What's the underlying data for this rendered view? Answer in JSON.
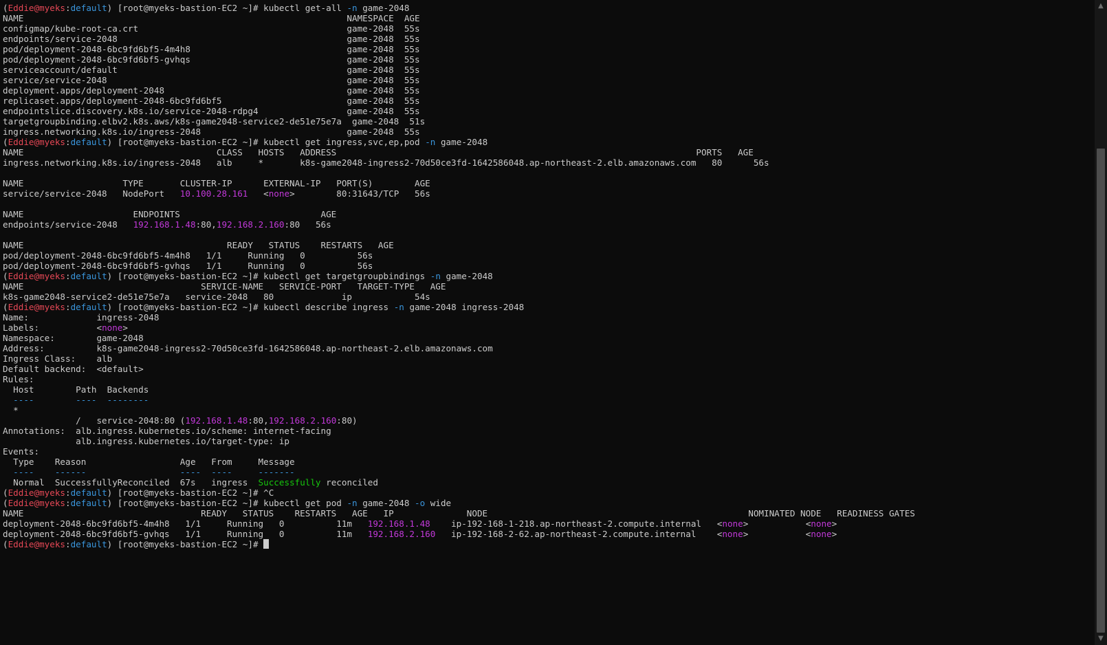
{
  "colors": {
    "background": "#0c0c0c",
    "text": "#cccccc",
    "user": "#e74856",
    "context": "#3a96dd",
    "flag": "#3a96dd",
    "ip": "#c239d9",
    "success": "#16c60c"
  },
  "scrollbar": {
    "up_icon": "chevron-up-icon",
    "down_icon": "chevron-down-icon",
    "position_fraction": 0.22,
    "visible_fraction": 0.78
  },
  "lines": [
    [
      [
        "p",
        "("
      ],
      [
        "user",
        "Eddie@myeks"
      ],
      [
        "p",
        ":"
      ],
      [
        "ctx",
        "default"
      ],
      [
        "p",
        ") [root@myeks-bastion-EC2 ~]# kubectl get-all "
      ],
      [
        "flag",
        "-n"
      ],
      [
        "p",
        " game-2048"
      ]
    ],
    [
      [
        "p",
        "NAME                                                              NAMESPACE  AGE"
      ]
    ],
    [
      [
        "p",
        "configmap/kube-root-ca.crt                                        game-2048  55s"
      ]
    ],
    [
      [
        "p",
        "endpoints/service-2048                                            game-2048  55s"
      ]
    ],
    [
      [
        "p",
        "pod/deployment-2048-6bc9fd6bf5-4m4h8                              game-2048  55s"
      ]
    ],
    [
      [
        "p",
        "pod/deployment-2048-6bc9fd6bf5-gvhqs                              game-2048  55s"
      ]
    ],
    [
      [
        "p",
        "serviceaccount/default                                            game-2048  55s"
      ]
    ],
    [
      [
        "p",
        "service/service-2048                                              game-2048  55s"
      ]
    ],
    [
      [
        "p",
        "deployment.apps/deployment-2048                                   game-2048  55s"
      ]
    ],
    [
      [
        "p",
        "replicaset.apps/deployment-2048-6bc9fd6bf5                        game-2048  55s"
      ]
    ],
    [
      [
        "p",
        "endpointslice.discovery.k8s.io/service-2048-rdpg4                 game-2048  55s"
      ]
    ],
    [
      [
        "p",
        "targetgroupbinding.elbv2.k8s.aws/k8s-game2048-service2-de51e75e7a  game-2048  51s"
      ]
    ],
    [
      [
        "p",
        "ingress.networking.k8s.io/ingress-2048                            game-2048  55s"
      ]
    ],
    [
      [
        "p",
        "("
      ],
      [
        "user",
        "Eddie@myeks"
      ],
      [
        "p",
        ":"
      ],
      [
        "ctx",
        "default"
      ],
      [
        "p",
        ") [root@myeks-bastion-EC2 ~]# kubectl get ingress,svc,ep,pod "
      ],
      [
        "flag",
        "-n"
      ],
      [
        "p",
        " game-2048"
      ]
    ],
    [
      [
        "p",
        "NAME                                     CLASS   HOSTS   ADDRESS                                                                     PORTS   AGE"
      ]
    ],
    [
      [
        "p",
        "ingress.networking.k8s.io/ingress-2048   alb     *       k8s-game2048-ingress2-70d50ce3fd-1642586048.ap-northeast-2.elb.amazonaws.com   80      56s"
      ]
    ],
    [
      [
        "p",
        ""
      ]
    ],
    [
      [
        "p",
        "NAME                   TYPE       CLUSTER-IP      EXTERNAL-IP   PORT(S)        AGE"
      ]
    ],
    [
      [
        "p",
        "service/service-2048   NodePort   "
      ],
      [
        "ip",
        "10.100.28.161"
      ],
      [
        "p",
        "   <"
      ],
      [
        "ip",
        "none"
      ],
      [
        "p",
        ">        80:31643/TCP   56s"
      ]
    ],
    [
      [
        "p",
        ""
      ]
    ],
    [
      [
        "p",
        "NAME                     ENDPOINTS                           AGE"
      ]
    ],
    [
      [
        "p",
        "endpoints/service-2048   "
      ],
      [
        "ip",
        "192.168.1.48"
      ],
      [
        "p",
        ":80,"
      ],
      [
        "ip",
        "192.168.2.160"
      ],
      [
        "p",
        ":80   56s"
      ]
    ],
    [
      [
        "p",
        ""
      ]
    ],
    [
      [
        "p",
        "NAME                                       READY   STATUS    RESTARTS   AGE"
      ]
    ],
    [
      [
        "p",
        "pod/deployment-2048-6bc9fd6bf5-4m4h8   1/1     Running   0          56s"
      ]
    ],
    [
      [
        "p",
        "pod/deployment-2048-6bc9fd6bf5-gvhqs   1/1     Running   0          56s"
      ]
    ],
    [
      [
        "p",
        "("
      ],
      [
        "user",
        "Eddie@myeks"
      ],
      [
        "p",
        ":"
      ],
      [
        "ctx",
        "default"
      ],
      [
        "p",
        ") [root@myeks-bastion-EC2 ~]# kubectl get targetgroupbindings "
      ],
      [
        "flag",
        "-n"
      ],
      [
        "p",
        " game-2048"
      ]
    ],
    [
      [
        "p",
        "NAME                                  SERVICE-NAME   SERVICE-PORT   TARGET-TYPE   AGE"
      ]
    ],
    [
      [
        "p",
        "k8s-game2048-service2-de51e75e7a   service-2048   80             ip            54s"
      ]
    ],
    [
      [
        "p",
        "("
      ],
      [
        "user",
        "Eddie@myeks"
      ],
      [
        "p",
        ":"
      ],
      [
        "ctx",
        "default"
      ],
      [
        "p",
        ") [root@myeks-bastion-EC2 ~]# kubectl describe ingress "
      ],
      [
        "flag",
        "-n"
      ],
      [
        "p",
        " game-2048 ingress-2048"
      ]
    ],
    [
      [
        "p",
        "Name:             ingress-2048"
      ]
    ],
    [
      [
        "p",
        "Labels:           <"
      ],
      [
        "ip",
        "none"
      ],
      [
        "p",
        ">"
      ]
    ],
    [
      [
        "p",
        "Namespace:        game-2048"
      ]
    ],
    [
      [
        "p",
        "Address:          k8s-game2048-ingress2-70d50ce3fd-1642586048.ap-northeast-2.elb.amazonaws.com"
      ]
    ],
    [
      [
        "p",
        "Ingress Class:    alb"
      ]
    ],
    [
      [
        "p",
        "Default backend:  <default>"
      ]
    ],
    [
      [
        "p",
        "Rules:"
      ]
    ],
    [
      [
        "p",
        "  Host        Path  Backends"
      ]
    ],
    [
      [
        "p",
        "  "
      ],
      [
        "ctx",
        "----        ----  --------"
      ]
    ],
    [
      [
        "p",
        "  *"
      ]
    ],
    [
      [
        "p",
        "              /   service-2048:80 ("
      ],
      [
        "ip",
        "192.168.1.48"
      ],
      [
        "p",
        ":80,"
      ],
      [
        "ip",
        "192.168.2.160"
      ],
      [
        "p",
        ":80)"
      ]
    ],
    [
      [
        "p",
        "Annotations:  alb.ingress.kubernetes.io/scheme: internet-facing"
      ]
    ],
    [
      [
        "p",
        "              alb.ingress.kubernetes.io/target-type: ip"
      ]
    ],
    [
      [
        "p",
        "Events:"
      ]
    ],
    [
      [
        "p",
        "  Type    Reason                  Age   From     Message"
      ]
    ],
    [
      [
        "p",
        "  "
      ],
      [
        "ctx",
        "----    ------                  ----  ----     -------"
      ]
    ],
    [
      [
        "p",
        "  Normal  SuccessfullyReconciled  67s   ingress  "
      ],
      [
        "ok",
        "Successfully"
      ],
      [
        "p",
        " reconciled"
      ]
    ],
    [
      [
        "p",
        "("
      ],
      [
        "user",
        "Eddie@myeks"
      ],
      [
        "p",
        ":"
      ],
      [
        "ctx",
        "default"
      ],
      [
        "p",
        ") [root@myeks-bastion-EC2 ~]# ^C"
      ]
    ],
    [
      [
        "p",
        "("
      ],
      [
        "user",
        "Eddie@myeks"
      ],
      [
        "p",
        ":"
      ],
      [
        "ctx",
        "default"
      ],
      [
        "p",
        ") [root@myeks-bastion-EC2 ~]# kubectl get pod "
      ],
      [
        "flag",
        "-n"
      ],
      [
        "p",
        " game-2048 "
      ],
      [
        "flag",
        "-o"
      ],
      [
        "p",
        " wide"
      ]
    ],
    [
      [
        "p",
        "NAME                                  READY   STATUS    RESTARTS   AGE   IP              NODE                                                  NOMINATED NODE   READINESS GATES"
      ]
    ],
    [
      [
        "p",
        "deployment-2048-6bc9fd6bf5-4m4h8   1/1     Running   0          11m   "
      ],
      [
        "ip",
        "192.168.1.48"
      ],
      [
        "p",
        "    ip-192-168-1-218.ap-northeast-2.compute.internal   <"
      ],
      [
        "ip",
        "none"
      ],
      [
        "p",
        ">           <"
      ],
      [
        "ip",
        "none"
      ],
      [
        "p",
        ">"
      ]
    ],
    [
      [
        "p",
        "deployment-2048-6bc9fd6bf5-gvhqs   1/1     Running   0          11m   "
      ],
      [
        "ip",
        "192.168.2.160"
      ],
      [
        "p",
        "   ip-192-168-2-62.ap-northeast-2.compute.internal    <"
      ],
      [
        "ip",
        "none"
      ],
      [
        "p",
        ">           <"
      ],
      [
        "ip",
        "none"
      ],
      [
        "p",
        ">"
      ]
    ],
    [
      [
        "p",
        "("
      ],
      [
        "user",
        "Eddie@myeks"
      ],
      [
        "p",
        ":"
      ],
      [
        "ctx",
        "default"
      ],
      [
        "p",
        ") [root@myeks-bastion-EC2 ~]# "
      ],
      [
        "cursor",
        ""
      ]
    ]
  ]
}
